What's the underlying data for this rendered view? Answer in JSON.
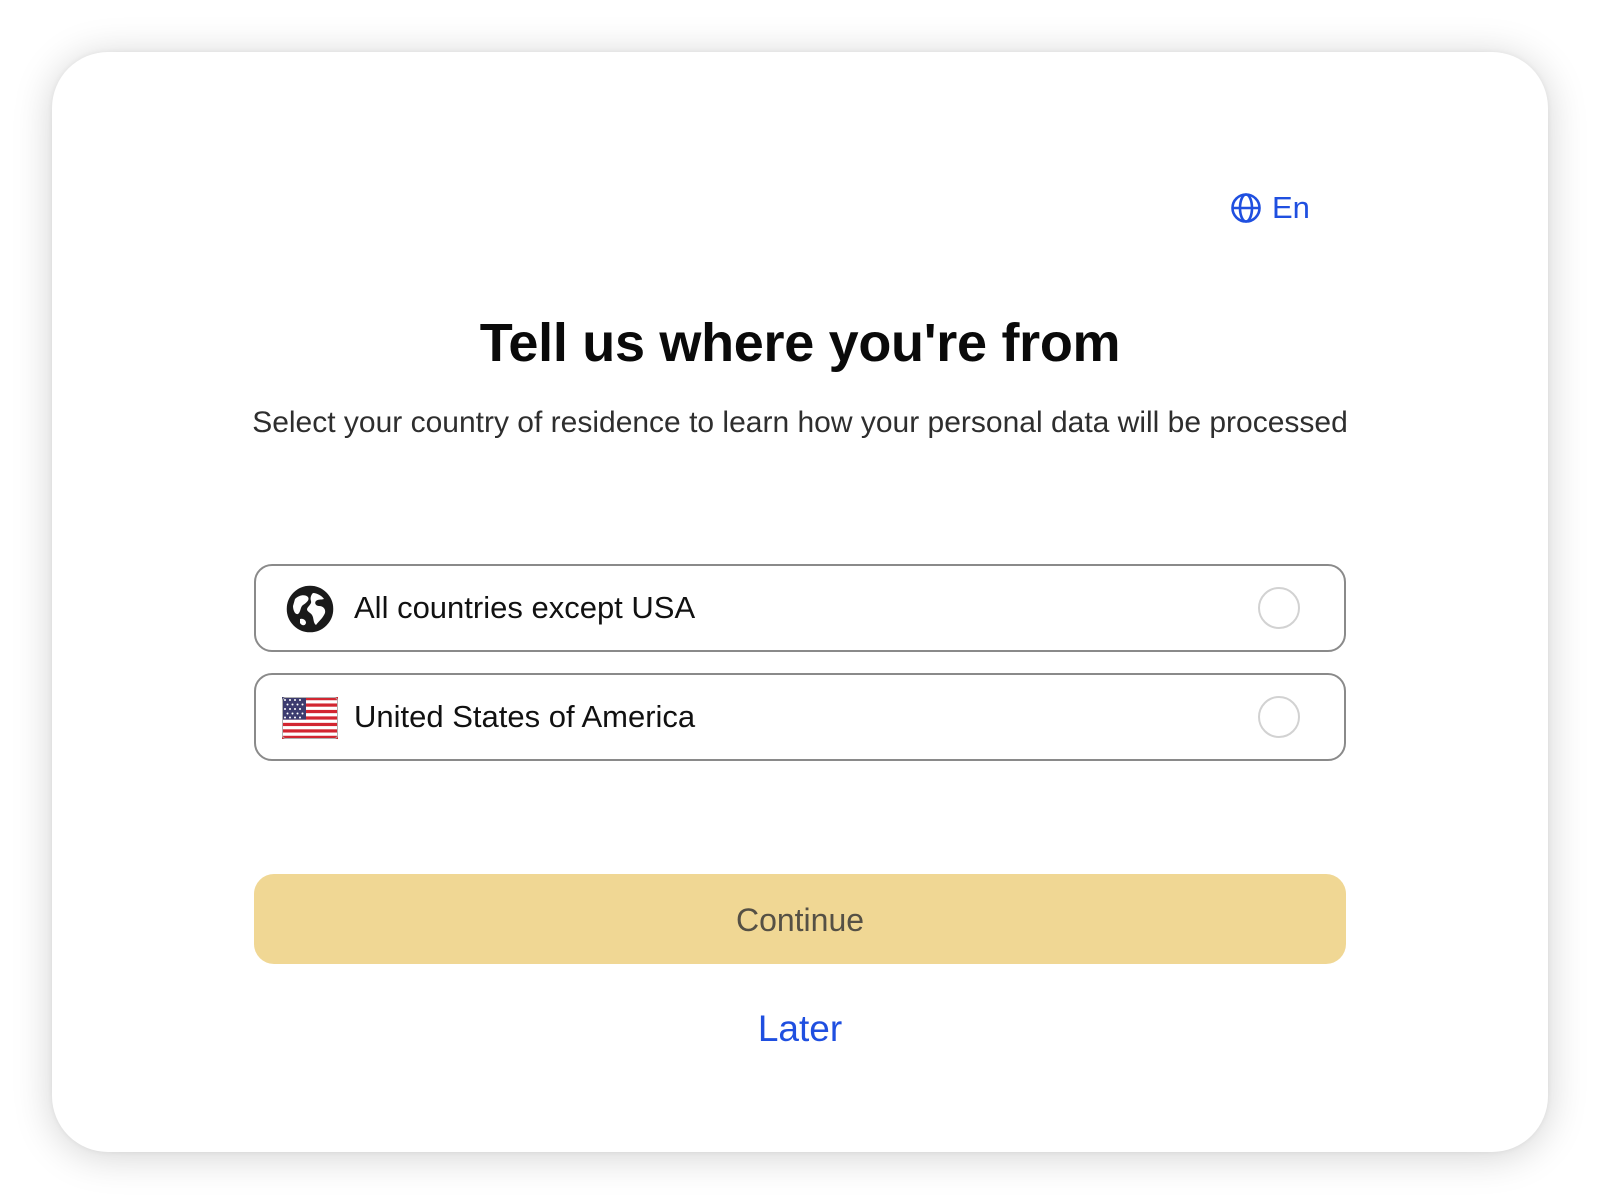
{
  "language_selector": {
    "label": "En",
    "icon": "globe-icon"
  },
  "title": "Tell us where you're from",
  "subtitle": "Select your country of residence to learn how your personal data will be processed",
  "options": [
    {
      "label": "All countries except USA",
      "icon": "world-globe-icon",
      "selected": false
    },
    {
      "label": "United States of America",
      "icon": "us-flag-icon",
      "selected": false
    }
  ],
  "continue_button": {
    "label": "Continue"
  },
  "later_link": {
    "label": "Later"
  },
  "colors": {
    "accent_link": "#1f4fe0",
    "continue_bg_disabled": "#f0d794",
    "option_border": "#8a8a8a"
  }
}
